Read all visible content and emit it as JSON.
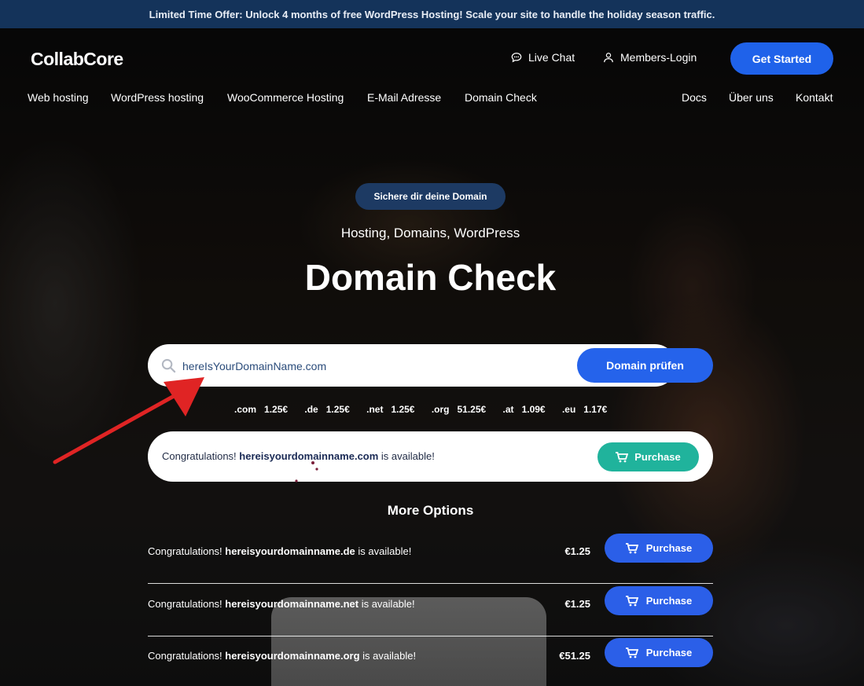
{
  "promo": {
    "text": "Limited Time Offer: Unlock 4 months of free WordPress Hosting! Scale your site to handle the holiday season traffic."
  },
  "header": {
    "logo": "CollabCore",
    "live_chat": "Live Chat",
    "members_login": "Members-Login",
    "get_started": "Get Started"
  },
  "nav": {
    "left": [
      "Web hosting",
      "WordPress hosting",
      "WooCommerce Hosting",
      "E-Mail Adresse",
      "Domain Check"
    ],
    "right": [
      "Docs",
      "Über uns",
      "Kontakt"
    ]
  },
  "hero": {
    "badge": "Sichere dir deine Domain",
    "subtitle": "Hosting, Domains, WordPress",
    "title": "Domain Check"
  },
  "search": {
    "value": "hereIsYourDomainName.com",
    "button": "Domain prüfen"
  },
  "prices": [
    {
      "tld": ".com",
      "price": "1.25€"
    },
    {
      "tld": ".de",
      "price": "1.25€"
    },
    {
      "tld": ".net",
      "price": "1.25€"
    },
    {
      "tld": ".org",
      "price": "51.25€"
    },
    {
      "tld": ".at",
      "price": "1.09€"
    },
    {
      "tld": ".eu",
      "price": "1.17€"
    }
  ],
  "result": {
    "prefix": "Congratulations!",
    "domain": "hereisyourdomainname.com",
    "suffix": "is available!",
    "button": "Purchase"
  },
  "more_options": {
    "title": "More Options",
    "items": [
      {
        "prefix": "Congratulations!",
        "domain": "hereisyourdomainname.de",
        "suffix": "is available!",
        "price": "€1.25",
        "button": "Purchase"
      },
      {
        "prefix": "Congratulations!",
        "domain": "hereisyourdomainname.net",
        "suffix": "is available!",
        "price": "€1.25",
        "button": "Purchase"
      },
      {
        "prefix": "Congratulations!",
        "domain": "hereisyourdomainname.org",
        "suffix": "is available!",
        "price": "€51.25",
        "button": "Purchase"
      }
    ]
  },
  "colors": {
    "promo_bg": "#14335a",
    "primary": "#2563eb",
    "purchase_teal": "#20b39c",
    "annotation_arrow": "#e02424"
  }
}
